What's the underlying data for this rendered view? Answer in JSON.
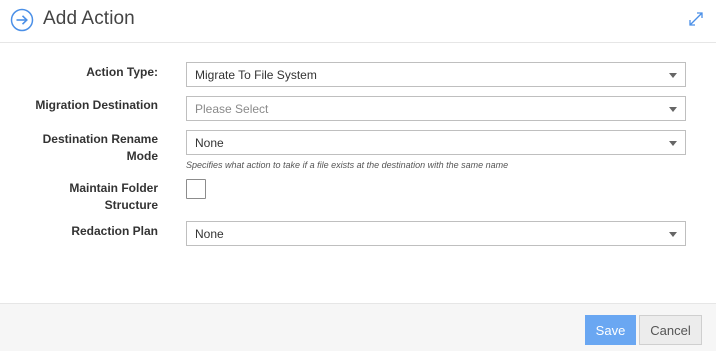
{
  "header": {
    "title": "Add Action",
    "icon": "arrow-circle-right-icon",
    "expand_icon": "expand-icon",
    "accent_color": "#4a8fe7"
  },
  "form": {
    "action_type": {
      "label": "Action Type:",
      "value": "Migrate To File System"
    },
    "migration_destination": {
      "label": "Migration Destination",
      "placeholder": "Please Select"
    },
    "destination_rename_mode": {
      "label_line1": "Destination Rename",
      "label_line2": "Mode",
      "value": "None",
      "hint": "Specifies what action to take if a file exists at the destination with the same name"
    },
    "maintain_folder_structure": {
      "label_line1": "Maintain Folder",
      "label_line2": "Structure",
      "checked": false
    },
    "redaction_plan": {
      "label": "Redaction Plan",
      "value": "None"
    }
  },
  "footer": {
    "save_label": "Save",
    "cancel_label": "Cancel",
    "save_color": "#6aa7f2"
  }
}
